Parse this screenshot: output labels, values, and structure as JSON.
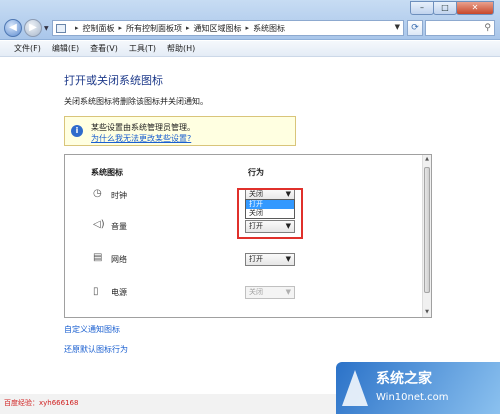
{
  "address": {
    "crumbs": [
      "控制面板",
      "所有控制面板项",
      "通知区域图标",
      "系统图标"
    ]
  },
  "menu": [
    "文件(F)",
    "编辑(E)",
    "查看(V)",
    "工具(T)",
    "帮助(H)"
  ],
  "page": {
    "title": "打开或关闭系统图标",
    "description": "关闭系统图标将删除该图标并关闭通知。"
  },
  "info": {
    "text": "某些设置由系统管理员管理。",
    "link": "为什么我无法更改某些设置?"
  },
  "table": {
    "headers": [
      "系统图标",
      "行为"
    ],
    "rows": [
      {
        "label": "时钟",
        "icon": "clock-icon",
        "value": "关闭",
        "disabled": false
      },
      {
        "label": "音量",
        "icon": "volume-icon",
        "value": "打开",
        "disabled": false
      },
      {
        "label": "网络",
        "icon": "network-icon",
        "value": "打开",
        "disabled": false
      },
      {
        "label": "电源",
        "icon": "power-icon",
        "value": "关闭",
        "disabled": true
      }
    ],
    "dropdown_options": [
      "打开",
      "关闭"
    ],
    "dropdown_selected": "打开"
  },
  "links": {
    "customize": "自定义通知图标",
    "restore": "还原默认图标行为"
  },
  "footer": {
    "watermark": "百度经验：xyh666168"
  },
  "logo": {
    "title": "系统之家",
    "url": "Win10net.com"
  },
  "colors": {
    "highlight": "#e0302b",
    "link": "#1a5fd0",
    "title": "#1e3a8a"
  }
}
